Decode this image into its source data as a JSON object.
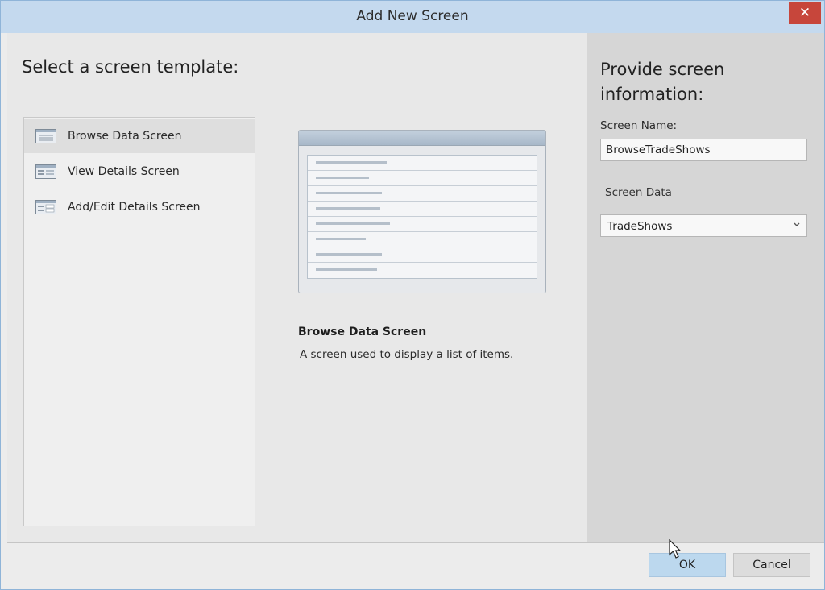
{
  "window": {
    "title": "Add New Screen",
    "close_label": "✕"
  },
  "templates": {
    "heading": "Select a screen template:",
    "items": [
      {
        "label": "Browse Data Screen",
        "icon": "browse-screen-icon",
        "selected": true
      },
      {
        "label": "View Details Screen",
        "icon": "details-screen-icon",
        "selected": false
      },
      {
        "label": "Add/Edit Details Screen",
        "icon": "edit-details-screen-icon",
        "selected": false
      }
    ]
  },
  "preview": {
    "title": "Browse Data Screen",
    "description": "A screen used to display a list of items."
  },
  "info": {
    "heading": "Provide screen information:",
    "screen_name_label": "Screen Name:",
    "screen_name_value": "BrowseTradeShows",
    "screen_data_label": "Screen Data",
    "screen_data_value": "TradeShows"
  },
  "buttons": {
    "ok": "OK",
    "cancel": "Cancel"
  },
  "colors": {
    "titlebar": "#c4d9ee",
    "close": "#c7463b",
    "ok": "#bcd8ee"
  }
}
